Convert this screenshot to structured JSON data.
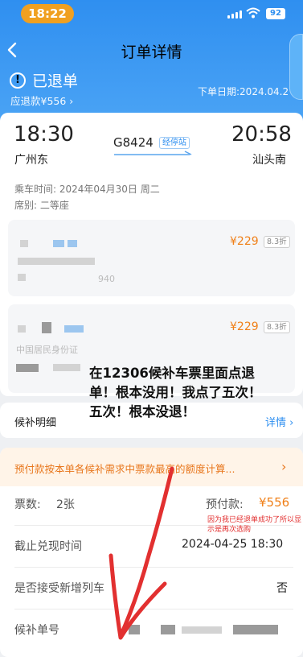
{
  "status_bar": {
    "time": "18:22",
    "battery": "92"
  },
  "header": {
    "title": "订单详情",
    "status": "已退单",
    "refund_amount": "应退款¥556 ›",
    "order_date": "下单日期:2024.04.2"
  },
  "trip": {
    "dep_time": "18:30",
    "arr_time": "20:58",
    "dep_station": "广州东",
    "arr_station": "汕头南",
    "train_no": "G8424",
    "stops_badge": "经停站",
    "ride_time": "乘车时间: 2024年04月30日 周二",
    "seat": "席别: 二等座"
  },
  "passengers": [
    {
      "price": "¥229",
      "discount": "8.3折",
      "fragment": "940"
    },
    {
      "price": "¥229",
      "discount": "8.3折",
      "fragment": "中国居民身份证"
    }
  ],
  "detail": {
    "label": "候补明细",
    "link": "详情 ›"
  },
  "notice": {
    "text": "预付款按本单各候补需求中票款最高的额度计算..."
  },
  "info": {
    "ticket_count_label": "票数:",
    "ticket_count_value": "2张",
    "prepay_label": "预付款:",
    "prepay_value": "¥556",
    "deadline_label": "截止兑现时间",
    "deadline_value": "2024-04-25 18:30",
    "new_train_label": "是否接受新增列车",
    "new_train_value": "否",
    "order_no_label": "候补单号"
  },
  "annotations": {
    "big": "在12306候补车票里面点退单！根本没用！我点了五次！五次！根本没退！",
    "small": "因为我已经退单成功了所以显示是再次选购"
  },
  "colors": {
    "header_blue": "#2f8ff0",
    "accent_orange": "#f08019",
    "annotation_red": "#e23030"
  }
}
